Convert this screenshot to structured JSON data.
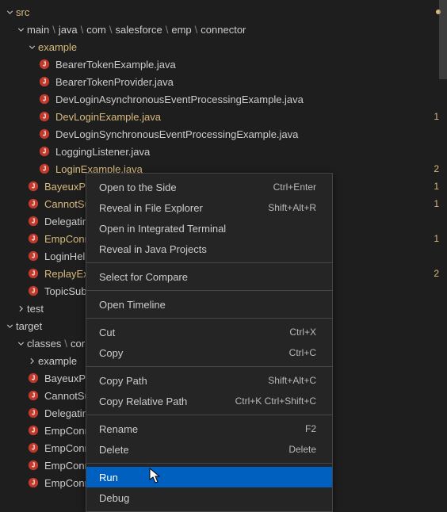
{
  "tree": {
    "root": {
      "name": "src",
      "expanded": true,
      "modified": true,
      "dotBadge": true
    },
    "path_parts": [
      "main",
      "java",
      "com",
      "salesforce",
      "emp",
      "connector"
    ],
    "example_folder": {
      "name": "example",
      "expanded": true,
      "modified": true
    },
    "example_files": [
      {
        "name": "BearerTokenExample.java",
        "modified": false,
        "badge": ""
      },
      {
        "name": "BearerTokenProvider.java",
        "modified": false,
        "badge": ""
      },
      {
        "name": "DevLoginAsynchronousEventProcessingExample.java",
        "modified": false,
        "badge": ""
      },
      {
        "name": "DevLoginExample.java",
        "modified": true,
        "badge": "1"
      },
      {
        "name": "DevLoginSynchronousEventProcessingExample.java",
        "modified": false,
        "badge": ""
      },
      {
        "name": "LoggingListener.java",
        "modified": false,
        "badge": ""
      },
      {
        "name": "LoginExample.java",
        "modified": true,
        "badge": "2"
      }
    ],
    "connector_files": [
      {
        "name": "BayeuxPar",
        "modified": true,
        "badge": "1"
      },
      {
        "name": "CannotSub",
        "modified": true,
        "badge": "1"
      },
      {
        "name": "Delegating",
        "modified": false,
        "badge": ""
      },
      {
        "name": "EmpConne",
        "modified": true,
        "badge": "1"
      },
      {
        "name": "LoginHelp",
        "modified": false,
        "badge": ""
      },
      {
        "name": "ReplayExte",
        "modified": true,
        "badge": "2"
      },
      {
        "name": "TopicSubs",
        "modified": false,
        "badge": ""
      }
    ],
    "test_folder": {
      "name": "test",
      "expanded": false
    },
    "target_folder": {
      "name": "target",
      "expanded": true,
      "modified": false
    },
    "classes_path": [
      "classes",
      "cor"
    ],
    "classes_example": {
      "name": "example",
      "expanded": false
    },
    "classes_files": [
      {
        "name": "BayeuxPar"
      },
      {
        "name": "CannotSub"
      },
      {
        "name": "Delegating"
      },
      {
        "name": "EmpConne"
      },
      {
        "name": "EmpConne"
      },
      {
        "name": "EmpConne"
      },
      {
        "name": "EmpConne"
      }
    ]
  },
  "menu": {
    "items": [
      {
        "label": "Open to the Side",
        "shortcut": "Ctrl+Enter"
      },
      {
        "label": "Reveal in File Explorer",
        "shortcut": "Shift+Alt+R"
      },
      {
        "label": "Open in Integrated Terminal",
        "shortcut": ""
      },
      {
        "label": "Reveal in Java Projects",
        "shortcut": ""
      },
      "sep",
      {
        "label": "Select for Compare",
        "shortcut": ""
      },
      "sep",
      {
        "label": "Open Timeline",
        "shortcut": ""
      },
      "sep",
      {
        "label": "Cut",
        "shortcut": "Ctrl+X"
      },
      {
        "label": "Copy",
        "shortcut": "Ctrl+C"
      },
      "sep",
      {
        "label": "Copy Path",
        "shortcut": "Shift+Alt+C"
      },
      {
        "label": "Copy Relative Path",
        "shortcut": "Ctrl+K Ctrl+Shift+C"
      },
      "sep",
      {
        "label": "Rename",
        "shortcut": "F2"
      },
      {
        "label": "Delete",
        "shortcut": "Delete"
      },
      "sep",
      {
        "label": "Run",
        "shortcut": "",
        "hovered": true
      },
      {
        "label": "Debug",
        "shortcut": ""
      }
    ]
  }
}
